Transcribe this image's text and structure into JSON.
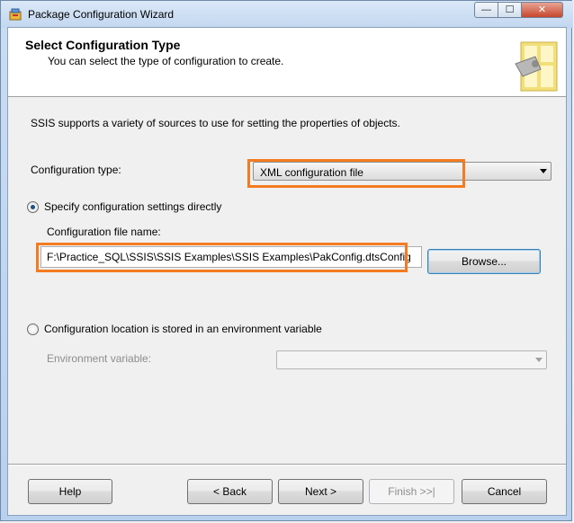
{
  "window": {
    "title": "Package Configuration Wizard",
    "controls": {
      "minimize": "—",
      "maximize": "☐",
      "close": "✕"
    }
  },
  "header": {
    "title": "Select Configuration Type",
    "subtitle": "You can select the type of configuration to create."
  },
  "body": {
    "intro": "SSIS supports a variety of sources to use for setting the properties of objects.",
    "config_type_label": "Configuration type:",
    "config_type_value": "XML configuration file",
    "radio_direct_label": "Specify configuration settings directly",
    "file_name_label": "Configuration file name:",
    "file_name_value": "F:\\Practice_SQL\\SSIS\\SSIS Examples\\SSIS Examples\\PakConfig.dtsConfig",
    "browse_label": "Browse...",
    "radio_env_label": "Configuration location is stored in an environment variable",
    "env_variable_label": "Environment variable:",
    "env_variable_value": ""
  },
  "footer": {
    "help": "Help",
    "back": "< Back",
    "next": "Next >",
    "finish": "Finish >>|",
    "cancel": "Cancel"
  },
  "colors": {
    "highlight": "#f47b20",
    "radio_dot": "#1c5180",
    "header_bg": "#ffffff"
  },
  "icons": [
    "app-icon",
    "wizard-header-icon",
    "dropdown-arrow-icon"
  ]
}
